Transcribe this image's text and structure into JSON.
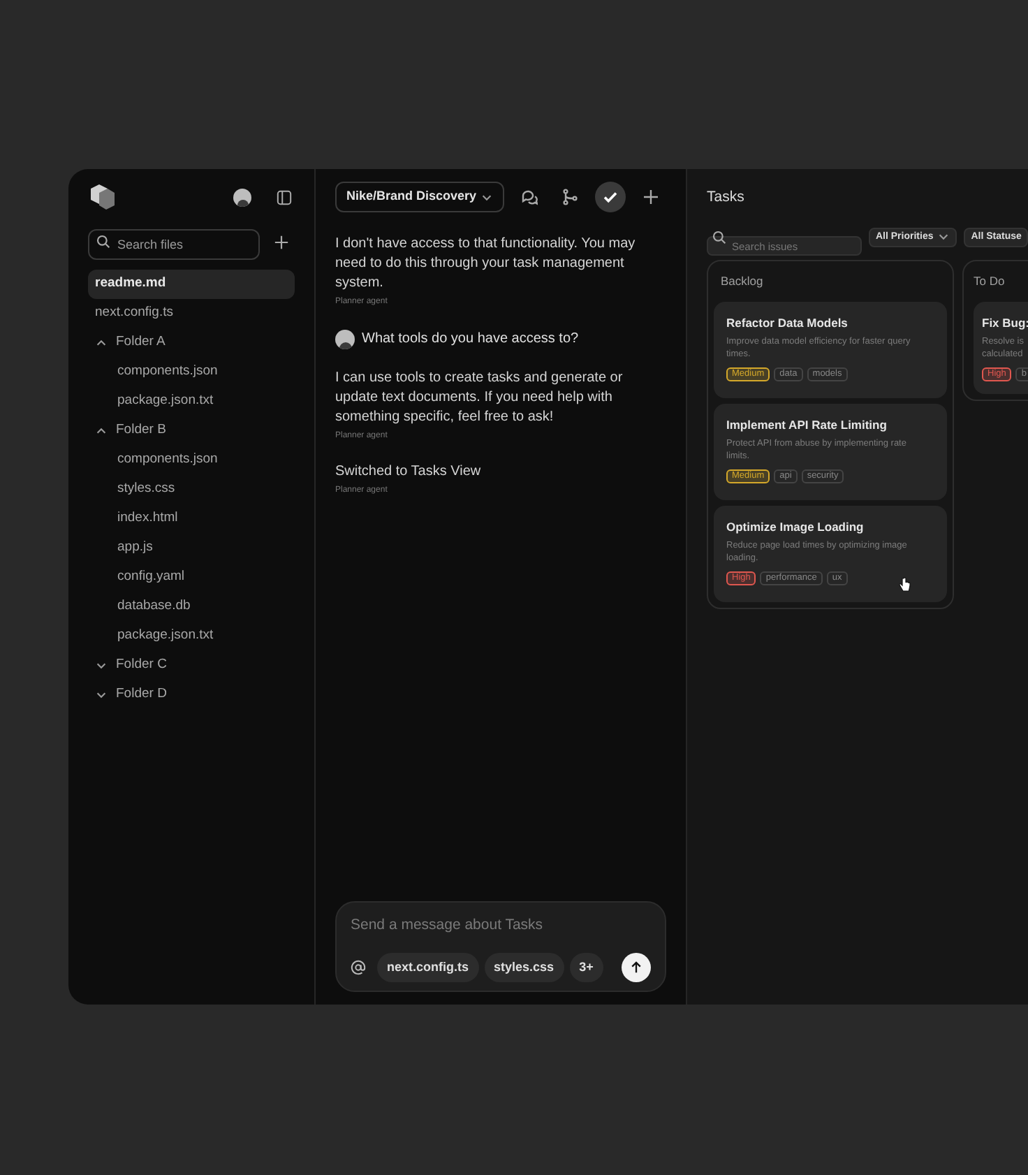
{
  "sidebar": {
    "search": {
      "placeholder": "Search files"
    },
    "items": [
      {
        "kind": "file",
        "name": "readme.md",
        "selected": true
      },
      {
        "kind": "file",
        "name": "next.config.ts",
        "selected": false
      },
      {
        "kind": "folder",
        "name": "Folder A",
        "expanded": true,
        "children": [
          {
            "kind": "file",
            "name": "components.json",
            "selected": false
          },
          {
            "kind": "file",
            "name": "package.json.txt",
            "selected": false
          }
        ]
      },
      {
        "kind": "folder",
        "name": "Folder B",
        "expanded": true,
        "children": [
          {
            "kind": "file",
            "name": "components.json",
            "selected": false
          },
          {
            "kind": "file",
            "name": "styles.css",
            "selected": false
          },
          {
            "kind": "file",
            "name": "index.html",
            "selected": false
          },
          {
            "kind": "file",
            "name": "app.js",
            "selected": false
          },
          {
            "kind": "file",
            "name": "config.yaml",
            "selected": false
          },
          {
            "kind": "file",
            "name": "database.db",
            "selected": false
          },
          {
            "kind": "file",
            "name": "package.json.txt",
            "selected": false
          }
        ]
      },
      {
        "kind": "folder",
        "name": "Folder C",
        "expanded": false
      },
      {
        "kind": "folder",
        "name": "Folder D",
        "expanded": false
      }
    ]
  },
  "chat": {
    "project": "Nike/Brand Discovery",
    "toolbar": [
      {
        "kind": "chat",
        "selected": false
      },
      {
        "kind": "branch",
        "selected": false
      },
      {
        "kind": "check",
        "selected": true
      },
      {
        "kind": "plus",
        "selected": false
      }
    ],
    "messages": [
      {
        "kind": "agent",
        "text": "I don't have access to that functionality. You may need to do this through your task management system.",
        "author": "Planner agent"
      },
      {
        "kind": "user",
        "text": "What tools do you have access to?"
      },
      {
        "kind": "agent",
        "text": "I can use tools to create tasks and generate or update text documents. If you need help with something specific, feel free to ask!",
        "author": "Planner agent"
      },
      {
        "kind": "agent",
        "text": "Switched to Tasks View",
        "author": "Planner agent"
      }
    ],
    "composer": {
      "placeholder": "Send a message about Tasks",
      "chips": [
        "next.config.ts",
        "styles.css",
        "3+"
      ]
    }
  },
  "tasks": {
    "title": "Tasks",
    "search": {
      "placeholder": "Search issues"
    },
    "filters": [
      {
        "label": "All Priorities",
        "caret": true
      },
      {
        "label": "All Statuse",
        "caret": false
      }
    ],
    "columns": [
      {
        "title": "Backlog",
        "cards": [
          {
            "title": "Refactor Data Models",
            "description": "Improve data model efficiency for faster query times.",
            "tags": [
              {
                "label": "Medium",
                "kind": "priority",
                "color": "#d4a82a"
              },
              {
                "label": "data",
                "kind": "tag"
              },
              {
                "label": "models",
                "kind": "tag"
              }
            ]
          },
          {
            "title": "Implement API Rate Limiting",
            "description": "Protect API from abuse by implementing rate limits.",
            "tags": [
              {
                "label": "Medium",
                "kind": "priority",
                "color": "#d4a82a"
              },
              {
                "label": "api",
                "kind": "tag"
              },
              {
                "label": "security",
                "kind": "tag"
              }
            ]
          },
          {
            "title": "Optimize Image Loading",
            "description": "Reduce page load times by optimizing image loading.",
            "tags": [
              {
                "label": "High",
                "kind": "priority",
                "color": "#e0574f"
              },
              {
                "label": "performance",
                "kind": "tag"
              },
              {
                "label": "ux",
                "kind": "tag"
              }
            ]
          }
        ]
      },
      {
        "title": "To Do",
        "cards": [
          {
            "title": "Fix Bug:",
            "description": "Resolve is calculated",
            "tags": [
              {
                "label": "High",
                "kind": "priority",
                "color": "#e0574f"
              },
              {
                "label": "b",
                "kind": "tag"
              }
            ]
          }
        ]
      }
    ]
  }
}
